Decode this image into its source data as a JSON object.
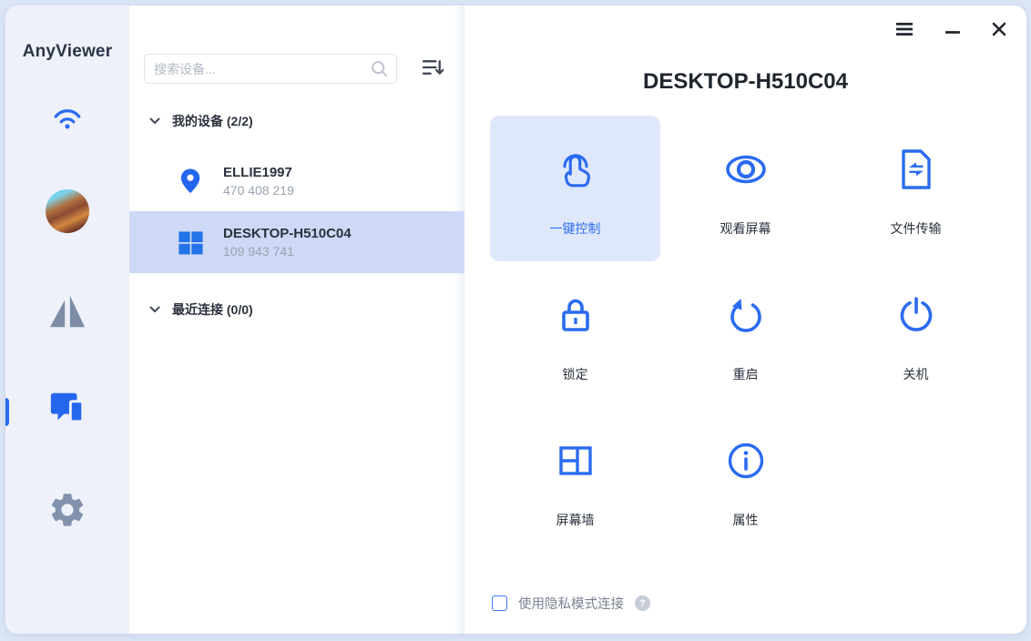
{
  "colors": {
    "accent_blue": "#2b6bf0",
    "selected_row_bg": "#cdd9f6",
    "selected_tile_bg": "#dfe8fb",
    "sidebar_bg": "#eef1fa",
    "window_bg": "#ffffff",
    "outer_bg": "#dce6f5",
    "muted_gray": "#9aa3b0",
    "icon_gray": "#8292ac"
  },
  "app": {
    "name": "AnyViewer"
  },
  "sidebar": {
    "items": [
      {
        "name": "connection",
        "icon": "wifi-icon",
        "active": false
      },
      {
        "name": "account",
        "icon": "user-avatar",
        "active": false
      },
      {
        "name": "mirror",
        "icon": "mirror-triangles-icon",
        "active": false
      },
      {
        "name": "devices",
        "icon": "devices-icon",
        "active": true
      },
      {
        "name": "settings",
        "icon": "gear-icon",
        "active": false
      }
    ]
  },
  "device_panel": {
    "search": {
      "placeholder": "搜索设备...",
      "value": ""
    },
    "groups": [
      {
        "label": "我的设备",
        "count": "(2/2)",
        "devices": [
          {
            "name": "ELLIE1997",
            "id": "470 408 219",
            "icon": "location-pin-icon",
            "selected": false
          },
          {
            "name": "DESKTOP-H510C04",
            "id": "109 943 741",
            "icon": "windows-logo-icon",
            "selected": true
          }
        ]
      },
      {
        "label": "最近连接",
        "count": "(0/0)",
        "devices": []
      }
    ]
  },
  "main": {
    "title": "DESKTOP-H510C04",
    "actions": [
      {
        "label": "一键控制",
        "icon": "one-click-control-icon",
        "selected": true
      },
      {
        "label": "观看屏幕",
        "icon": "view-screen-icon",
        "selected": false
      },
      {
        "label": "文件传输",
        "icon": "file-transfer-icon",
        "selected": false
      },
      {
        "label": "锁定",
        "icon": "lock-icon",
        "selected": false
      },
      {
        "label": "重启",
        "icon": "restart-icon",
        "selected": false
      },
      {
        "label": "关机",
        "icon": "power-icon",
        "selected": false
      },
      {
        "label": "屏幕墙",
        "icon": "screen-wall-icon",
        "selected": false
      },
      {
        "label": "属性",
        "icon": "info-icon",
        "selected": false
      }
    ],
    "privacy": {
      "label": "使用隐私模式连接",
      "checked": false,
      "help_glyph": "?"
    }
  }
}
